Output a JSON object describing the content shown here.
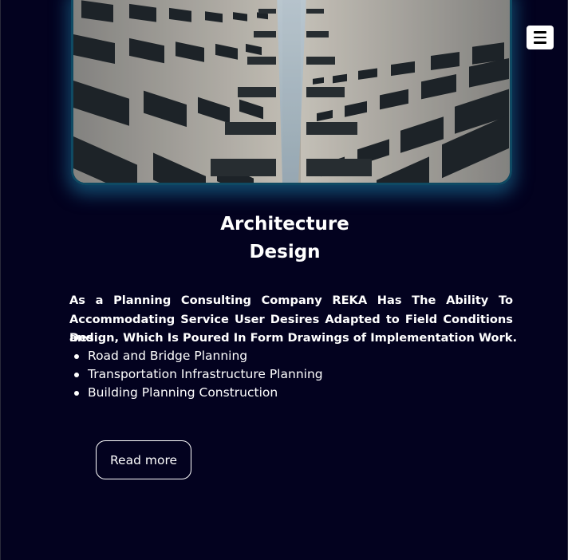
{
  "header": {
    "menu_icon": "hamburger-menu-icon"
  },
  "hero": {
    "image": "building-facade-upward-view",
    "glow_color": "#1e82aa"
  },
  "service": {
    "title_line1": "Architecture",
    "title_line2": "Design",
    "description_justified": "As a Planning Consulting Company REKA Has The Ability To Accommodating Service User Desires Adapted to Field Conditions and",
    "description_last_line": "Design, Which Is Poured In Form Drawings of Implementation Work.",
    "items": [
      "Road and Bridge Planning",
      "Transportation Infrastructure Planning",
      "Building Planning Construction"
    ],
    "read_more_label": "Read more"
  },
  "colors": {
    "background": "#03021f",
    "text": "#ffffff"
  }
}
